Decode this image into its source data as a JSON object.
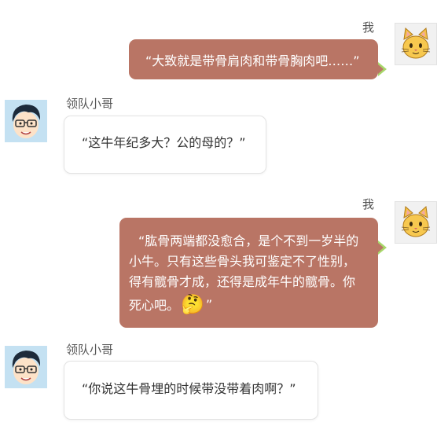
{
  "messages": [
    {
      "sender": "我",
      "text": "“大致就是带骨肩肉和带骨胸肉吧……”"
    },
    {
      "sender": "领队小哥",
      "text": "“这牛年纪多大？公的母的？”"
    },
    {
      "sender": "我",
      "lines": [
        "“肱骨两端都没愈合，是个不到一岁半的",
        "小牛。只有这些骨头我可鉴定不了性别，",
        "得有髋骨才成，还得是成年牛的髋骨。你",
        "死心吧。",
        "”"
      ],
      "emoji": "🤔"
    },
    {
      "sender": "领队小哥",
      "text": "“你说这牛骨埋的时候带没带着肉啊？”"
    }
  ],
  "colors": {
    "my_bubble": "#b97565",
    "bubble_tail": "#a7d86a"
  },
  "icons": {
    "my_avatar": "cat-face-icon",
    "other_avatar": "cartoon-boy-avatar-icon"
  }
}
